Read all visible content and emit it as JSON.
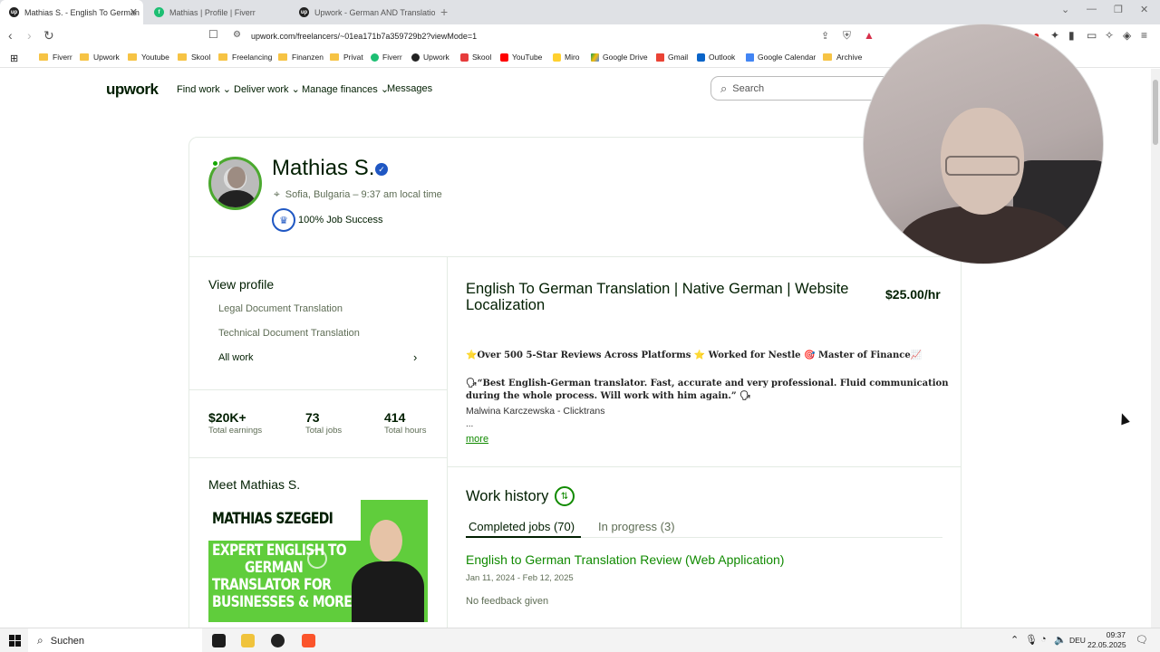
{
  "browser": {
    "tabs": [
      {
        "title": "Mathias S. - English To German",
        "icon": "upwork-icon",
        "active": true
      },
      {
        "title": "Mathias | Profile | Fiverr",
        "icon": "fiverr-icon",
        "active": false
      },
      {
        "title": "Upwork - German AND Translation",
        "icon": "upwork-icon",
        "active": false
      }
    ],
    "new_tab": "+",
    "url": "upwork.com/freelancers/~01ea171b7a359729b2?viewMode=1",
    "bookmarks": [
      "Fiverr",
      "Upwork",
      "Youtube",
      "Skool",
      "Freelancing",
      "Finanzen",
      "Privat",
      "Fiverr",
      "Upwork",
      "Skool",
      "YouTube",
      "Miro",
      "Google Drive",
      "Gmail",
      "Outlook",
      "Google Calendar",
      "Archive"
    ]
  },
  "upwork": {
    "logo": "upwork",
    "nav": [
      "Find work",
      "Deliver work",
      "Manage finances",
      "Messages"
    ],
    "search_placeholder": "Search"
  },
  "profile": {
    "name": "Mathias S.",
    "location": "Sofia, Bulgaria – 9:37 am local time",
    "job_success": "100% Job Success"
  },
  "sidebar": {
    "view_profile": "View profile",
    "items": [
      "Legal Document Translation",
      "Technical Document Translation",
      "All work"
    ],
    "stats": [
      {
        "value": "$20K+",
        "label": "Total earnings"
      },
      {
        "value": "73",
        "label": "Total jobs"
      },
      {
        "value": "414",
        "label": "Total hours"
      }
    ],
    "meet": "Meet Mathias S.",
    "video_lines": [
      "MATHIAS SZEGEDI",
      "EXPERT ENGLISH TO",
      "GERMAN",
      "TRANSLATOR FOR",
      "BUSINESSES & MORE"
    ]
  },
  "main": {
    "title": "English To German Translation | Native German | Website Localization",
    "rate": "$25.00/hr",
    "overview_line1": "⭐Over 500 5-Star Reviews Across Platforms ⭐ Worked for Nestle 🎯 Master of Finance📈",
    "quote_line1": "🗣“Best English-German translator. Fast, accurate and very professional. Fluid communication",
    "quote_line2": "during the whole process. Will work with him again.” 🗣",
    "quote_author": "Malwina Karczewska - Clicktrans",
    "ellipsis": "...",
    "more": "more",
    "work_history": "Work history",
    "tabs": [
      "Completed jobs (70)",
      "In progress (3)"
    ],
    "job": {
      "title": "English to German Translation Review (Web Application)",
      "dates": "Jan 11, 2024 - Feb 12, 2025",
      "feedback": "No feedback given"
    }
  },
  "taskbar": {
    "search": "Suchen",
    "lang": "DEU",
    "time": "09:37",
    "date": "22.05.2025"
  },
  "colors": {
    "green": "#108a00",
    "upwork_dark": "#001e00",
    "muted": "#5e6d55",
    "verified_blue": "#1f57c3"
  }
}
